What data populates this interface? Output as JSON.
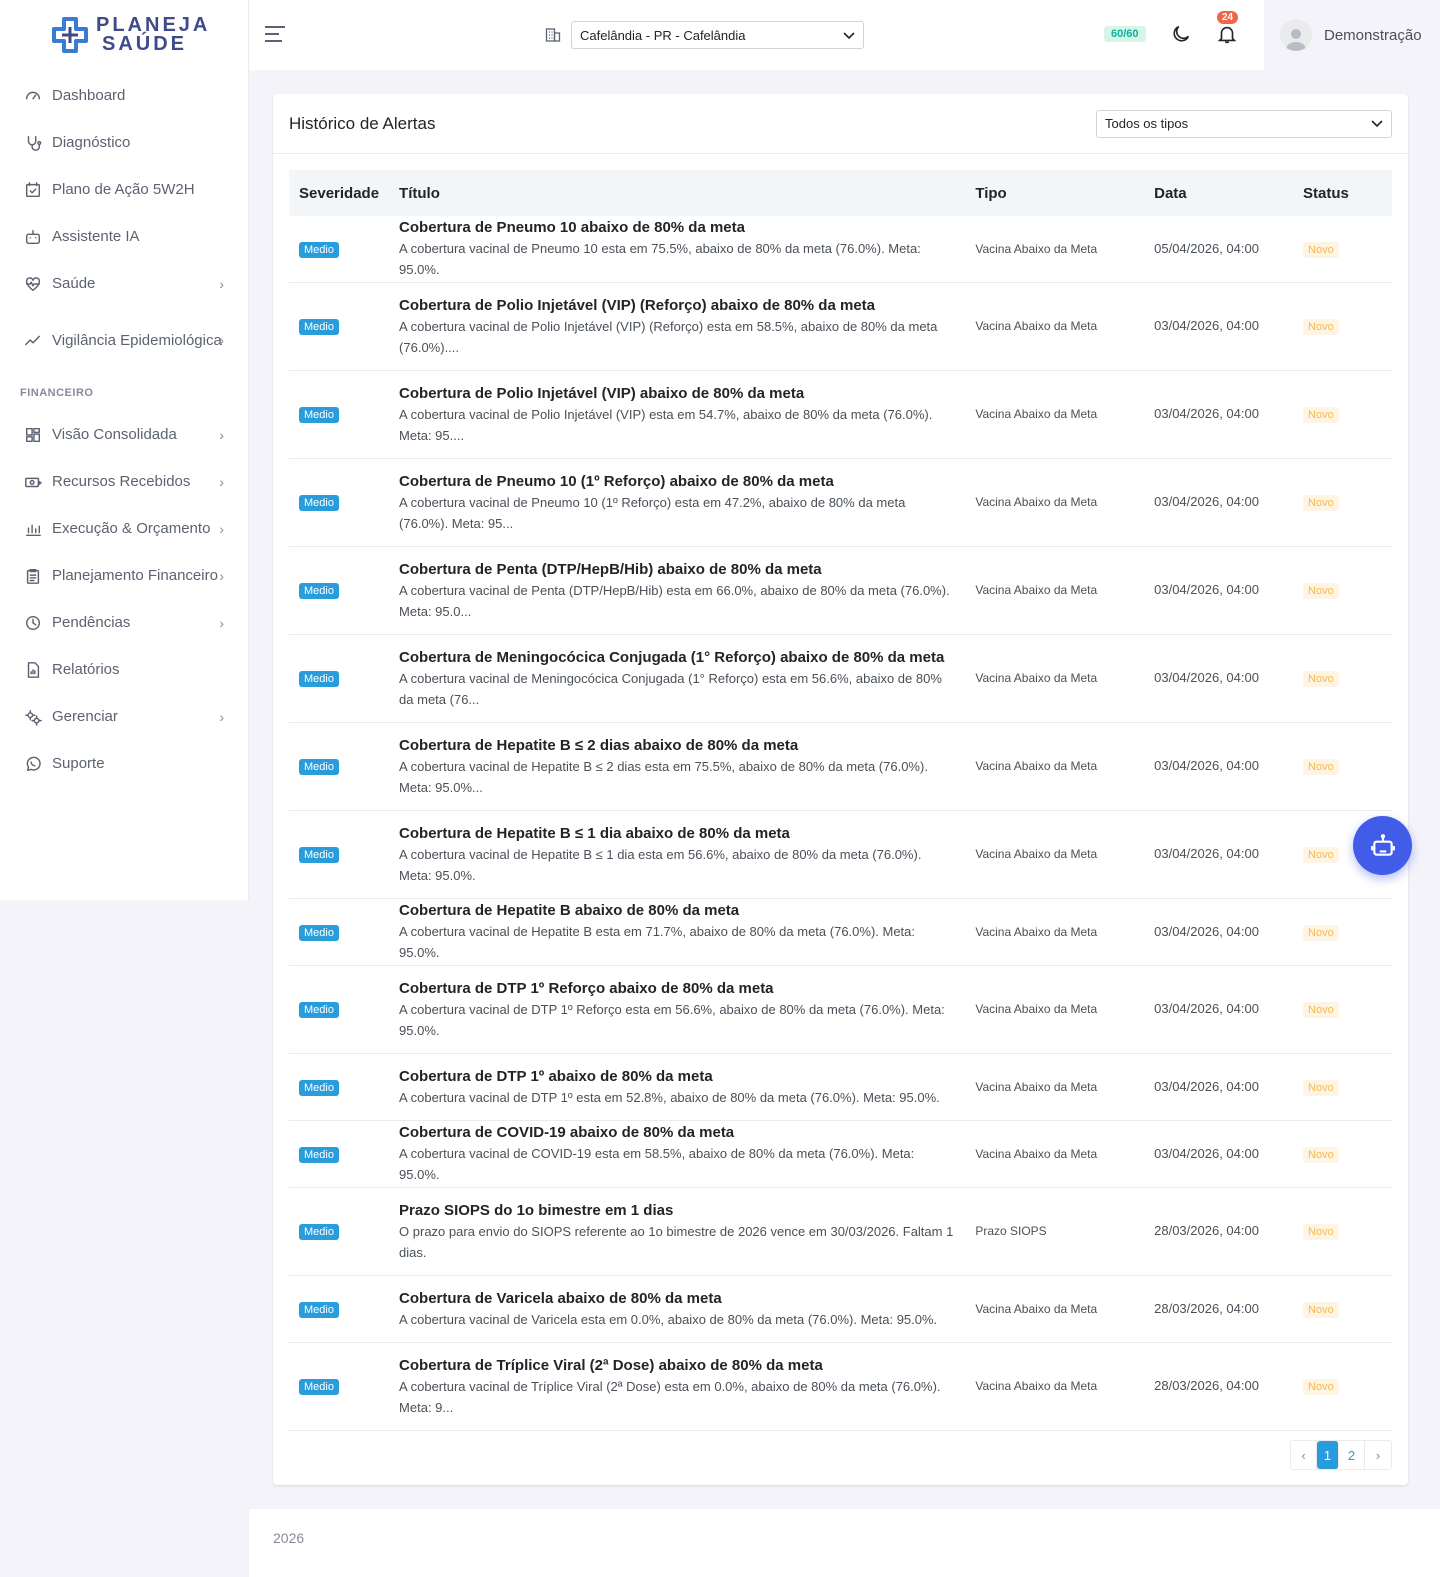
{
  "brand": {
    "line1": "PLANEJA",
    "line2": "SAÚDE"
  },
  "sidebar": {
    "items": [
      {
        "label": "Dashboard",
        "icon": "gauge-icon"
      },
      {
        "label": "Diagnóstico",
        "icon": "stethoscope-icon"
      },
      {
        "label": "Plano de Ação 5W2H",
        "icon": "calendar-check-icon"
      },
      {
        "label": "Assistente IA",
        "icon": "robot-icon"
      },
      {
        "label": "Saúde",
        "icon": "heart-pulse-icon",
        "chevron": "›"
      },
      {
        "label": "Vigilância Epidemiológica",
        "icon": "trend-icon",
        "chevron": "›"
      }
    ],
    "section": "FINANCEIRO",
    "fin_items": [
      {
        "label": "Visão Consolidada",
        "icon": "dashboard-grid-icon",
        "chevron": "›"
      },
      {
        "label": "Recursos Recebidos",
        "icon": "money-icon",
        "chevron": "›"
      },
      {
        "label": "Execução & Orçamento",
        "icon": "chart-icon",
        "chevron": "›"
      },
      {
        "label": "Planejamento Financeiro",
        "icon": "clipboard-icon",
        "chevron": "›"
      },
      {
        "label": "Pendências",
        "icon": "clock-icon",
        "chevron": "›"
      },
      {
        "label": "Relatórios",
        "icon": "report-icon"
      },
      {
        "label": "Gerenciar",
        "icon": "gears-icon",
        "chevron": "›"
      },
      {
        "label": "Suporte",
        "icon": "whatsapp-icon"
      }
    ]
  },
  "header": {
    "city": "Cafelândia - PR - Cafelândia",
    "quota": "60/60",
    "notifications": "24",
    "user": "Demonstração"
  },
  "card": {
    "title": "Histórico de Alertas",
    "filter": "Todos os tipos",
    "columns": [
      "Severidade",
      "Título",
      "Tipo",
      "Data",
      "Status"
    ],
    "rows": [
      {
        "sev": "Medio",
        "title": "Cobertura de Pneumo 10 abaixo de 80% da meta",
        "desc": "A cobertura vacinal de Pneumo 10 esta em 75.5%, abaixo de 80% da meta (76.0%). Meta: 95.0%.",
        "tipo": "Vacina Abaixo da Meta",
        "data": "05/04/2026, 04:00",
        "status": "Novo"
      },
      {
        "sev": "Medio",
        "title": "Cobertura de Polio Injetável (VIP) (Reforço) abaixo de 80% da meta",
        "desc": "A cobertura vacinal de Polio Injetável (VIP) (Reforço) esta em 58.5%, abaixo de 80% da meta (76.0%)....",
        "tipo": "Vacina Abaixo da Meta",
        "data": "03/04/2026, 04:00",
        "status": "Novo"
      },
      {
        "sev": "Medio",
        "title": "Cobertura de Polio Injetável (VIP) abaixo de 80% da meta",
        "desc": "A cobertura vacinal de Polio Injetável (VIP) esta em 54.7%, abaixo de 80% da meta (76.0%). Meta: 95....",
        "tipo": "Vacina Abaixo da Meta",
        "data": "03/04/2026, 04:00",
        "status": "Novo"
      },
      {
        "sev": "Medio",
        "title": "Cobertura de Pneumo 10 (1º Reforço) abaixo de 80% da meta",
        "desc": "A cobertura vacinal de Pneumo 10 (1º Reforço) esta em 47.2%, abaixo de 80% da meta (76.0%). Meta: 95...",
        "tipo": "Vacina Abaixo da Meta",
        "data": "03/04/2026, 04:00",
        "status": "Novo"
      },
      {
        "sev": "Medio",
        "title": "Cobertura de Penta (DTP/HepB/Hib) abaixo de 80% da meta",
        "desc": "A cobertura vacinal de Penta (DTP/HepB/Hib) esta em 66.0%, abaixo de 80% da meta (76.0%). Meta: 95.0...",
        "tipo": "Vacina Abaixo da Meta",
        "data": "03/04/2026, 04:00",
        "status": "Novo"
      },
      {
        "sev": "Medio",
        "title": "Cobertura de Meningocócica Conjugada (1° Reforço) abaixo de 80% da meta",
        "desc": "A cobertura vacinal de Meningocócica Conjugada (1° Reforço) esta em 56.6%, abaixo de 80% da meta (76...",
        "tipo": "Vacina Abaixo da Meta",
        "data": "03/04/2026, 04:00",
        "status": "Novo"
      },
      {
        "sev": "Medio",
        "title": "Cobertura de Hepatite B ≤ 2 dias abaixo de 80% da meta",
        "desc": "A cobertura vacinal de Hepatite B ≤ 2 dias esta em 75.5%, abaixo de 80% da meta (76.0%). Meta: 95.0%...",
        "tipo": "Vacina Abaixo da Meta",
        "data": "03/04/2026, 04:00",
        "status": "Novo"
      },
      {
        "sev": "Medio",
        "title": "Cobertura de Hepatite B ≤ 1 dia abaixo de 80% da meta",
        "desc": "A cobertura vacinal de Hepatite B ≤ 1 dia esta em 56.6%, abaixo de 80% da meta (76.0%). Meta: 95.0%.",
        "tipo": "Vacina Abaixo da Meta",
        "data": "03/04/2026, 04:00",
        "status": "Novo"
      },
      {
        "sev": "Medio",
        "title": "Cobertura de Hepatite B abaixo de 80% da meta",
        "desc": "A cobertura vacinal de Hepatite B esta em 71.7%, abaixo de 80% da meta (76.0%). Meta: 95.0%.",
        "tipo": "Vacina Abaixo da Meta",
        "data": "03/04/2026, 04:00",
        "status": "Novo"
      },
      {
        "sev": "Medio",
        "title": "Cobertura de DTP 1º Reforço abaixo de 80% da meta",
        "desc": "A cobertura vacinal de DTP 1º Reforço esta em 56.6%, abaixo de 80% da meta (76.0%). Meta: 95.0%.",
        "tipo": "Vacina Abaixo da Meta",
        "data": "03/04/2026, 04:00",
        "status": "Novo"
      },
      {
        "sev": "Medio",
        "title": "Cobertura de DTP 1º abaixo de 80% da meta",
        "desc": "A cobertura vacinal de DTP 1º esta em 52.8%, abaixo de 80% da meta (76.0%). Meta: 95.0%.",
        "tipo": "Vacina Abaixo da Meta",
        "data": "03/04/2026, 04:00",
        "status": "Novo"
      },
      {
        "sev": "Medio",
        "title": "Cobertura de COVID-19 abaixo de 80% da meta",
        "desc": "A cobertura vacinal de COVID-19 esta em 58.5%, abaixo de 80% da meta (76.0%). Meta: 95.0%.",
        "tipo": "Vacina Abaixo da Meta",
        "data": "03/04/2026, 04:00",
        "status": "Novo"
      },
      {
        "sev": "Medio",
        "title": "Prazo SIOPS do 1o bimestre em 1 dias",
        "desc": "O prazo para envio do SIOPS referente ao 1o bimestre de 2026 vence em 30/03/2026. Faltam 1 dias.",
        "tipo": "Prazo SIOPS",
        "data": "28/03/2026, 04:00",
        "status": "Novo"
      },
      {
        "sev": "Medio",
        "title": "Cobertura de Varicela abaixo de 80% da meta",
        "desc": "A cobertura vacinal de Varicela esta em 0.0%, abaixo de 80% da meta (76.0%). Meta: 95.0%.",
        "tipo": "Vacina Abaixo da Meta",
        "data": "28/03/2026, 04:00",
        "status": "Novo"
      },
      {
        "sev": "Medio",
        "title": "Cobertura de Tríplice Viral (2ª Dose) abaixo de 80% da meta",
        "desc": "A cobertura vacinal de Tríplice Viral (2ª Dose) esta em 0.0%, abaixo de 80% da meta (76.0%). Meta: 9...",
        "tipo": "Vacina Abaixo da Meta",
        "data": "28/03/2026, 04:00",
        "status": "Novo"
      }
    ],
    "pagination": {
      "prev": "‹",
      "pages": [
        "1",
        "2"
      ],
      "next": "›"
    }
  },
  "footer": {
    "text": "2026"
  },
  "colors": {
    "primary": "#299cdb",
    "warning": "#f7b84b",
    "fab": "#405ce8",
    "brand": "#3f4a8a"
  }
}
